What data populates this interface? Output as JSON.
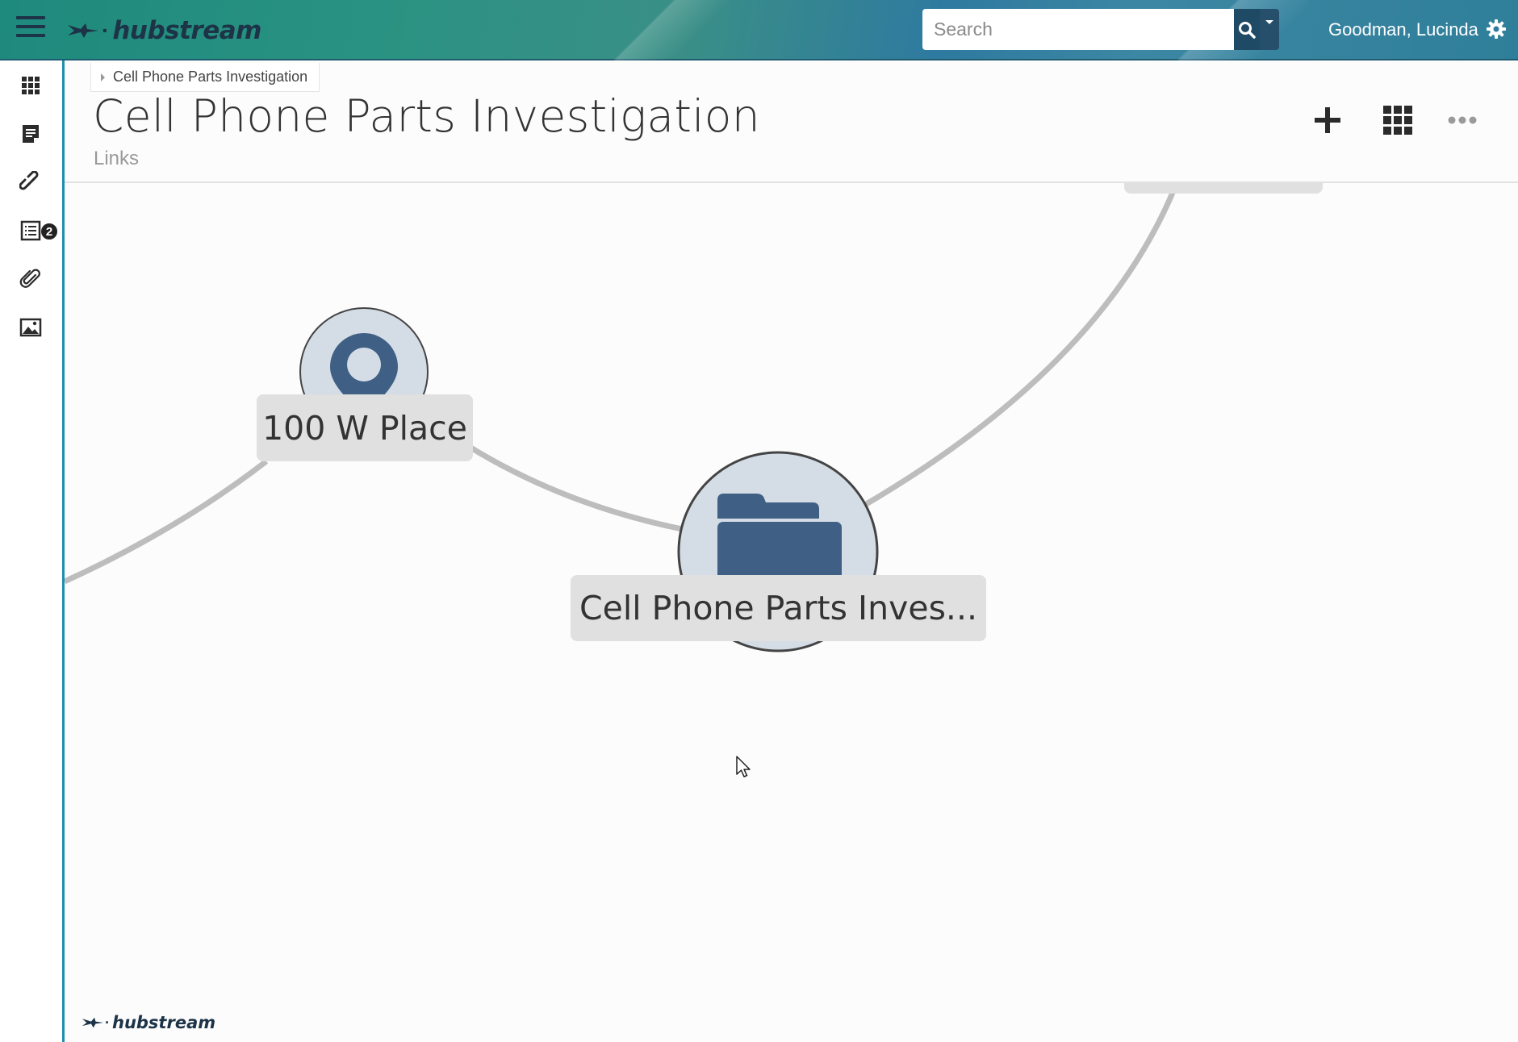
{
  "app": {
    "brand": "hubstream",
    "colors": {
      "topbar_teal": "#1e8a7d",
      "topbar_blue": "#2e7aa0",
      "brand_navy": "#1d3347",
      "node_fill": "#d4dde6",
      "node_icon": "#3f5f85",
      "edge": "#bdbdbd",
      "rail_border": "#1f8fb0"
    }
  },
  "topbar": {
    "menu_icon": "hamburger-icon",
    "search": {
      "placeholder": "Search",
      "value": ""
    },
    "user_name": "Goodman, Lucinda",
    "settings_icon": "gear-icon"
  },
  "sidebar": {
    "items": [
      {
        "name": "dashboard",
        "icon": "grid-icon"
      },
      {
        "name": "notes",
        "icon": "note-icon"
      },
      {
        "name": "links",
        "icon": "link-icon",
        "badge": "2"
      },
      {
        "name": "list",
        "icon": "list-icon"
      },
      {
        "name": "attachments",
        "icon": "paperclip-icon"
      },
      {
        "name": "images",
        "icon": "image-icon"
      }
    ]
  },
  "header": {
    "breadcrumb": "Cell Phone Parts Investigation",
    "title": "Cell Phone Parts Investigation",
    "subtitle": "Links",
    "actions": [
      {
        "name": "add",
        "icon": "plus-icon"
      },
      {
        "name": "layout",
        "icon": "grid-icon"
      },
      {
        "name": "more",
        "icon": "ellipsis-icon"
      }
    ]
  },
  "graph": {
    "nodes": [
      {
        "id": "location",
        "label": "100 W Place",
        "icon": "map-pin-icon"
      },
      {
        "id": "case",
        "label": "Cell Phone Parts Inves...",
        "icon": "folder-icon"
      }
    ]
  },
  "footer": {
    "brand": "hubstream"
  }
}
